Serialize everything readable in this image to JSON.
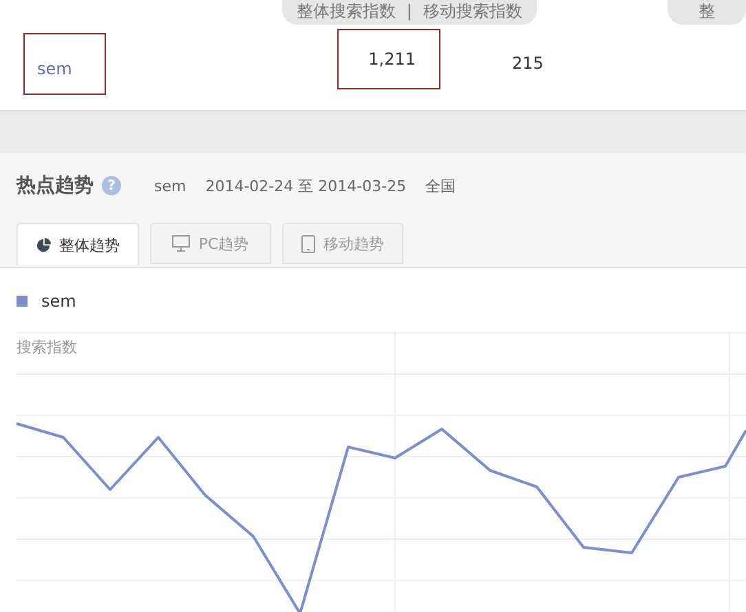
{
  "column_headers": [
    {
      "labels": [
        "整体搜索指数",
        "移动搜索指数"
      ],
      "separator": "|"
    },
    {
      "labels": [
        "整"
      ]
    }
  ],
  "row": {
    "keyword": "sem",
    "keyword_highlighted": true,
    "overall": "1,211",
    "overall_highlighted": true,
    "mobile": "215"
  },
  "section": {
    "title": "热点趋势",
    "help": "?",
    "keyword": "sem",
    "date_range": "2014-02-24 至 2014-03-25",
    "region": "全国"
  },
  "tabs": [
    {
      "label": "整体趋势",
      "kind": "overall",
      "selected": true
    },
    {
      "label": "PC趋势",
      "kind": "pc",
      "selected": false
    },
    {
      "label": "移动趋势",
      "kind": "mobile",
      "selected": false
    }
  ],
  "legend": [
    {
      "label": "sem",
      "color": "#7b8fc9"
    }
  ],
  "chart": {
    "ylabel": "搜索指数"
  }
}
